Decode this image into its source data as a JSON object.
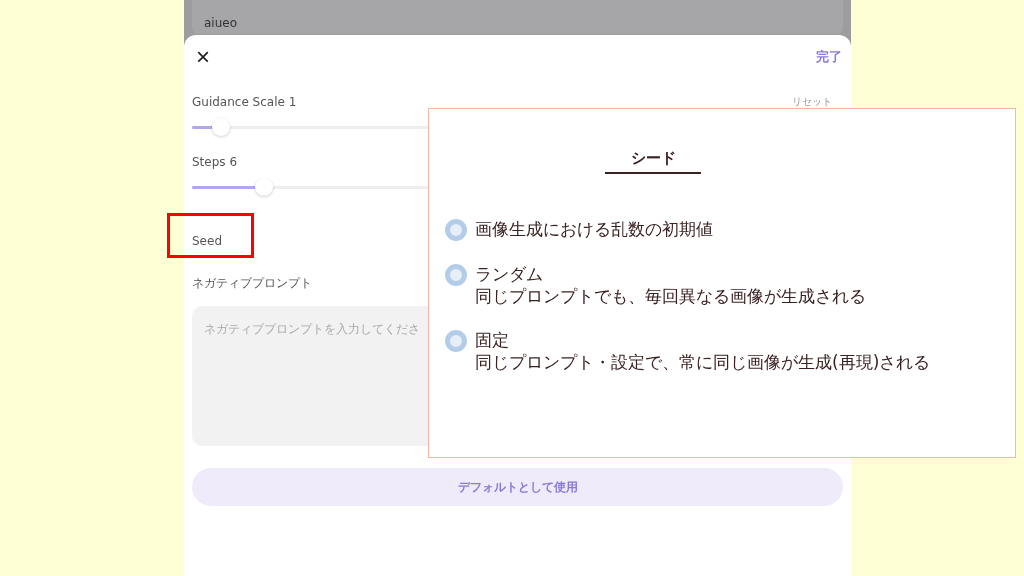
{
  "prompt_field": {
    "value": "aiueo"
  },
  "sheet": {
    "close": "×",
    "done": "完了",
    "reset": "リセット"
  },
  "sliders": [
    {
      "label": "Guidance Scale 1",
      "level": 0.044
    },
    {
      "label": "Steps 6",
      "level": 0.11
    }
  ],
  "seed": {
    "label": "Seed",
    "highlighted": true
  },
  "negative_prompt": {
    "label": "ネガティブプロンプト",
    "placeholder": "ネガティブプロンプトを入力してくださ"
  },
  "default_button": "デフォルトとして使用",
  "callout": {
    "title": "シード",
    "items": [
      {
        "text": "画像生成における乱数の初期値"
      },
      {
        "text": "ランダム",
        "detail": "同じプロンプトでも、毎回異なる画像が生成される"
      },
      {
        "text": "固定",
        "detail": "同じプロンプト・設定で、常に同じ画像が生成(再現)される"
      }
    ]
  }
}
